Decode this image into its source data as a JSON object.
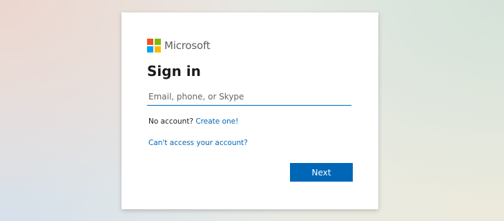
{
  "brand": {
    "name": "Microsoft",
    "logo_colors": [
      "#f25022",
      "#7fba00",
      "#00a4ef",
      "#ffb900"
    ]
  },
  "title": "Sign in",
  "email_field": {
    "value": "",
    "placeholder": "Email, phone, or Skype"
  },
  "no_account": {
    "text": "No account?",
    "link": "Create one!"
  },
  "cant_access_link": "Can't access your account?",
  "next_button": "Next",
  "colors": {
    "accent": "#0067b8",
    "title_text": "#1b1b1b",
    "logo_text": "#5e5e5e"
  }
}
